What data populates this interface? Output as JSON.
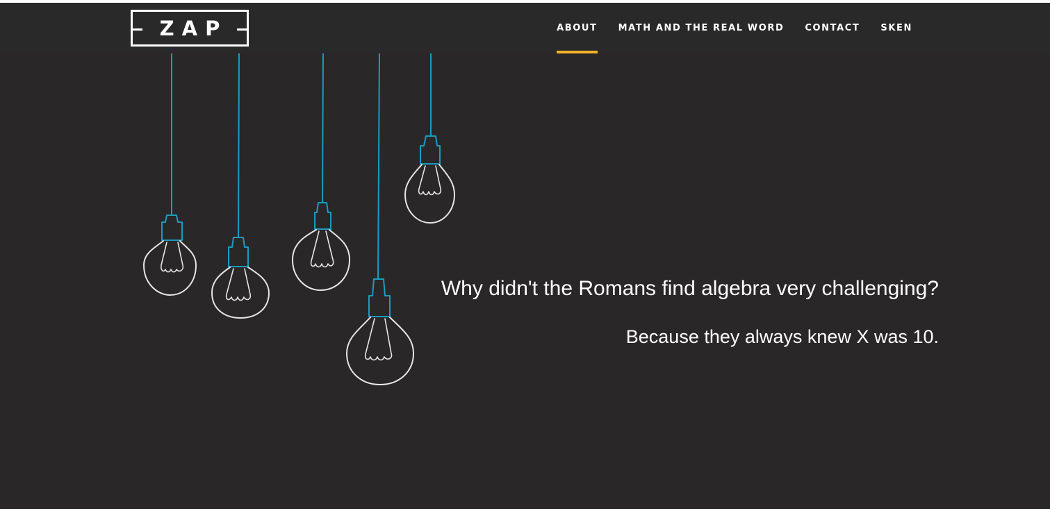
{
  "brand": {
    "logo_text": "ZAP"
  },
  "nav": {
    "items": [
      {
        "label": "ABOUT",
        "active": true
      },
      {
        "label": "MATH AND THE REAL WORD",
        "active": false
      },
      {
        "label": "CONTACT",
        "active": false
      },
      {
        "label": "SKEN",
        "active": false
      }
    ]
  },
  "hero": {
    "question": "Why didn't the Romans find algebra very challenging?",
    "answer": "Because they always knew X was 10.",
    "illustration": "hanging-light-bulbs"
  },
  "colors": {
    "background": "#2a2728",
    "navbar": "#292929",
    "accent": "#f4b12b",
    "cord": "#1a9cc0",
    "text": "#ffffff"
  }
}
